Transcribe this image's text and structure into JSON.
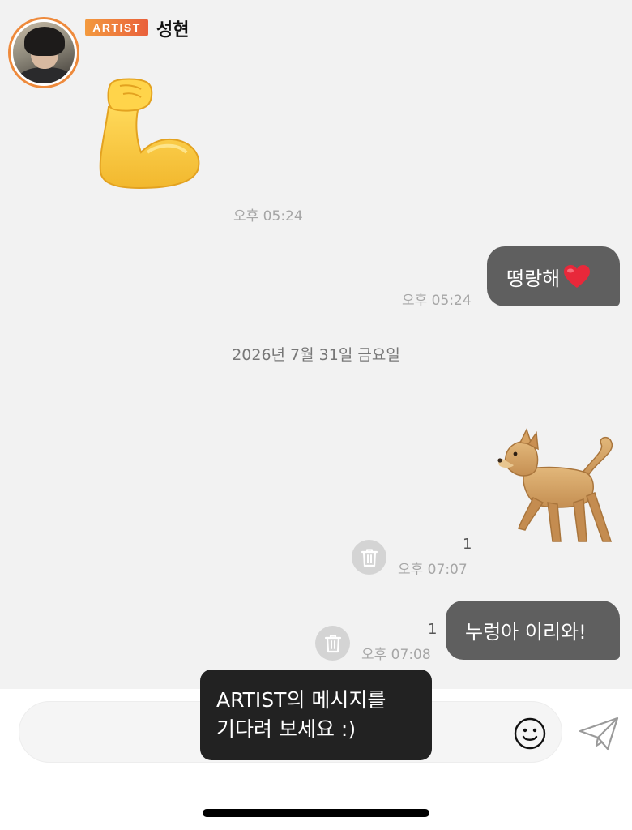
{
  "header": {
    "badge": "ARTIST",
    "name": "성현"
  },
  "messages": [
    {
      "type": "sticker",
      "from": "artist",
      "icon": "flexed-biceps-emoji",
      "time": "오후 05:24"
    },
    {
      "type": "text",
      "from": "me",
      "text": "떵랑해",
      "icon": "red-heart-emoji",
      "time": "오후 05:24"
    },
    {
      "type": "sticker",
      "from": "me",
      "icon": "dog-emoji",
      "time": "오후 07:07",
      "unread": "1"
    },
    {
      "type": "text",
      "from": "me",
      "text": "누렁아 이리와!",
      "time": "오후 07:08",
      "unread": "1"
    }
  ],
  "date_separator": "2026년 7월 31일 금요일",
  "composer": {
    "tooltip_line1": "ARTIST의 메시지를",
    "tooltip_line2": "기다려 보세요 :)",
    "emoji_icon": "smiley-icon",
    "send_icon": "paper-plane-icon"
  },
  "colors": {
    "badge_gradient_start": "#f39a3e",
    "badge_gradient_end": "#e9603c",
    "bubble": "#5f5f5f",
    "chat_background": "#f2f2f2",
    "tooltip": "#222222"
  }
}
